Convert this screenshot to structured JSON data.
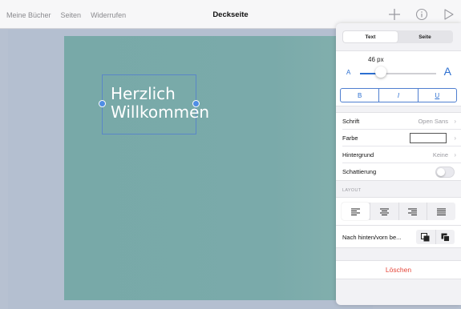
{
  "toolbar": {
    "left_items": [
      "Meine Bücher",
      "Seiten",
      "Widerrufen"
    ],
    "title": "Deckseite",
    "icons": [
      "plus-icon",
      "info-icon",
      "play-icon"
    ]
  },
  "slide": {
    "text": "Herzlich\nWillkommen"
  },
  "panel": {
    "segments": [
      "Text",
      "Seite"
    ],
    "active_segment": "Text",
    "font_size": "46 px",
    "size_small_label": "A",
    "size_large_label": "A",
    "size_slider_fraction": 0.27,
    "style_buttons": [
      "B",
      "I",
      "U"
    ],
    "rows": [
      {
        "label": "Schrift",
        "value": "Open Sans"
      },
      {
        "label": "Farbe",
        "swatch": "#ffffff"
      },
      {
        "label": "Hintergrund",
        "value": "Keine"
      },
      {
        "label": "Schattierung",
        "toggle": false
      }
    ],
    "layout_label": "LAYOUT",
    "alignments": [
      "align-left-icon",
      "align-center-icon",
      "align-right-icon",
      "align-justify-icon"
    ],
    "active_alignment": "align-left-icon",
    "order_label": "Nach hinten/vorn be...",
    "order_buttons": [
      "send-backward-icon",
      "bring-forward-icon"
    ],
    "delete_label": "Löschen"
  },
  "colors": {
    "accent": "#2c6fd1",
    "slide_bg": "#78a9a8",
    "delete": "#e5463a"
  }
}
